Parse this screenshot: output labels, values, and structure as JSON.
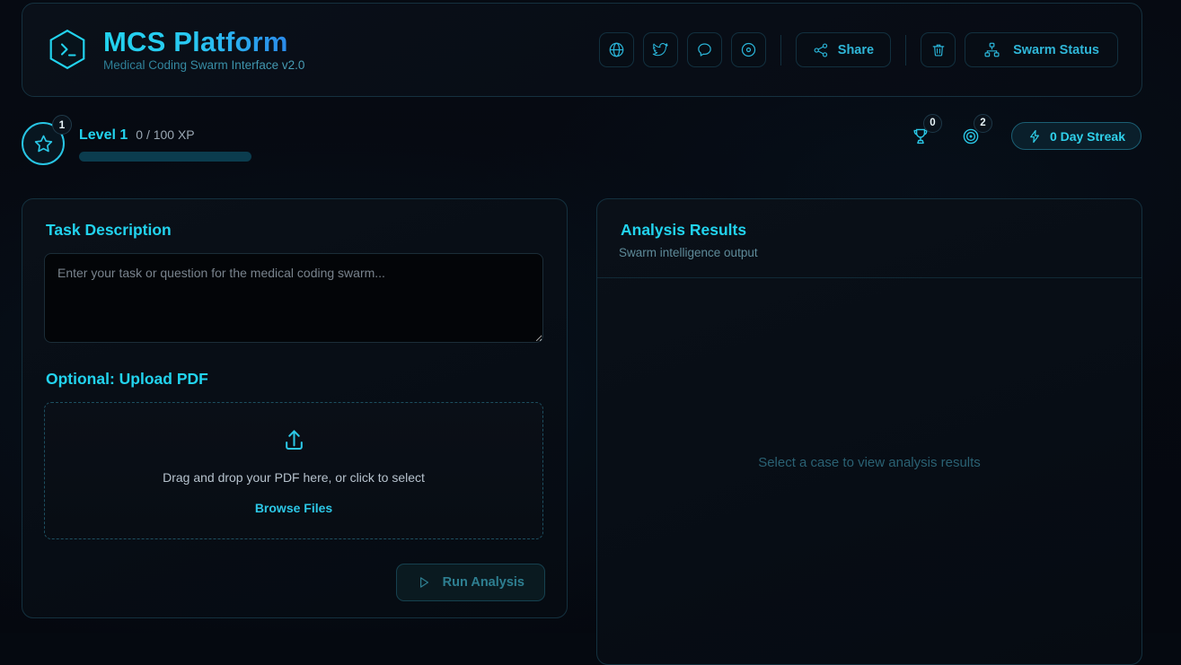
{
  "header": {
    "logo_icon": "hexagon-terminal-icon",
    "title": "MCS Platform",
    "subtitle": "Medical Coding Swarm Interface v2.0",
    "icon_buttons": [
      {
        "name": "globe-icon",
        "label": "Website"
      },
      {
        "name": "twitter-icon",
        "label": "Twitter"
      },
      {
        "name": "chat-icon",
        "label": "Chat"
      },
      {
        "name": "disc-icon",
        "label": "Record"
      }
    ],
    "share_label": "Share",
    "share_icon": "share-nodes-icon",
    "trash_icon": "trash-icon",
    "swarm_status_label": "Swarm  Status",
    "swarm_status_icon": "hierarchy-icon"
  },
  "level": {
    "badge_number": "1",
    "badge_icon": "star-icon",
    "title": "Level 1",
    "xp": "0 / 100 XP",
    "progress_percent": 0,
    "stats": [
      {
        "icon": "trophy-icon",
        "count": "0"
      },
      {
        "icon": "target-icon",
        "count": "2"
      }
    ],
    "streak_icon": "lightning-bolt-icon",
    "streak_label": "0 Day Streak"
  },
  "task_panel": {
    "title": "Task Description",
    "textarea_value": "",
    "textarea_placeholder": "Enter your task or question for the medical coding swarm...",
    "upload_title": "Optional: Upload PDF",
    "upload_icon": "upload-icon",
    "dropzone_text": "Drag and drop your PDF here, or click to select",
    "browse_label": "Browse Files",
    "run_icon": "play-icon",
    "run_label": "Run Analysis"
  },
  "results_panel": {
    "title": "Analysis Results",
    "subtitle": "Swarm intelligence output",
    "empty_message": "Select a case to view analysis results"
  },
  "colors": {
    "accent": "#22d3ee",
    "accent_blue": "#2b7fe8",
    "panel_border": "#14313f",
    "background": "#060a12"
  }
}
